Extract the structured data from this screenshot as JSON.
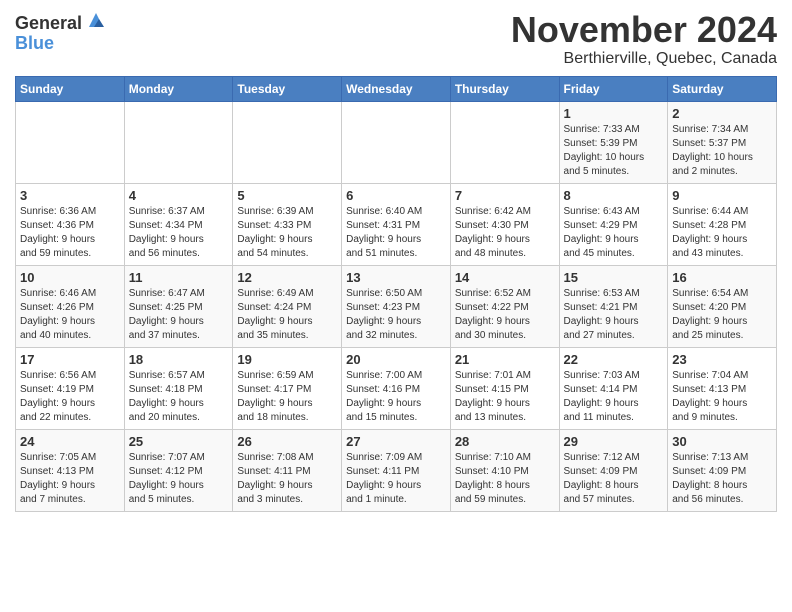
{
  "logo": {
    "general": "General",
    "blue": "Blue"
  },
  "header": {
    "month": "November 2024",
    "location": "Berthierville, Quebec, Canada"
  },
  "weekdays": [
    "Sunday",
    "Monday",
    "Tuesday",
    "Wednesday",
    "Thursday",
    "Friday",
    "Saturday"
  ],
  "weeks": [
    [
      {
        "day": "",
        "info": ""
      },
      {
        "day": "",
        "info": ""
      },
      {
        "day": "",
        "info": ""
      },
      {
        "day": "",
        "info": ""
      },
      {
        "day": "",
        "info": ""
      },
      {
        "day": "1",
        "info": "Sunrise: 7:33 AM\nSunset: 5:39 PM\nDaylight: 10 hours\nand 5 minutes."
      },
      {
        "day": "2",
        "info": "Sunrise: 7:34 AM\nSunset: 5:37 PM\nDaylight: 10 hours\nand 2 minutes."
      }
    ],
    [
      {
        "day": "3",
        "info": "Sunrise: 6:36 AM\nSunset: 4:36 PM\nDaylight: 9 hours\nand 59 minutes."
      },
      {
        "day": "4",
        "info": "Sunrise: 6:37 AM\nSunset: 4:34 PM\nDaylight: 9 hours\nand 56 minutes."
      },
      {
        "day": "5",
        "info": "Sunrise: 6:39 AM\nSunset: 4:33 PM\nDaylight: 9 hours\nand 54 minutes."
      },
      {
        "day": "6",
        "info": "Sunrise: 6:40 AM\nSunset: 4:31 PM\nDaylight: 9 hours\nand 51 minutes."
      },
      {
        "day": "7",
        "info": "Sunrise: 6:42 AM\nSunset: 4:30 PM\nDaylight: 9 hours\nand 48 minutes."
      },
      {
        "day": "8",
        "info": "Sunrise: 6:43 AM\nSunset: 4:29 PM\nDaylight: 9 hours\nand 45 minutes."
      },
      {
        "day": "9",
        "info": "Sunrise: 6:44 AM\nSunset: 4:28 PM\nDaylight: 9 hours\nand 43 minutes."
      }
    ],
    [
      {
        "day": "10",
        "info": "Sunrise: 6:46 AM\nSunset: 4:26 PM\nDaylight: 9 hours\nand 40 minutes."
      },
      {
        "day": "11",
        "info": "Sunrise: 6:47 AM\nSunset: 4:25 PM\nDaylight: 9 hours\nand 37 minutes."
      },
      {
        "day": "12",
        "info": "Sunrise: 6:49 AM\nSunset: 4:24 PM\nDaylight: 9 hours\nand 35 minutes."
      },
      {
        "day": "13",
        "info": "Sunrise: 6:50 AM\nSunset: 4:23 PM\nDaylight: 9 hours\nand 32 minutes."
      },
      {
        "day": "14",
        "info": "Sunrise: 6:52 AM\nSunset: 4:22 PM\nDaylight: 9 hours\nand 30 minutes."
      },
      {
        "day": "15",
        "info": "Sunrise: 6:53 AM\nSunset: 4:21 PM\nDaylight: 9 hours\nand 27 minutes."
      },
      {
        "day": "16",
        "info": "Sunrise: 6:54 AM\nSunset: 4:20 PM\nDaylight: 9 hours\nand 25 minutes."
      }
    ],
    [
      {
        "day": "17",
        "info": "Sunrise: 6:56 AM\nSunset: 4:19 PM\nDaylight: 9 hours\nand 22 minutes."
      },
      {
        "day": "18",
        "info": "Sunrise: 6:57 AM\nSunset: 4:18 PM\nDaylight: 9 hours\nand 20 minutes."
      },
      {
        "day": "19",
        "info": "Sunrise: 6:59 AM\nSunset: 4:17 PM\nDaylight: 9 hours\nand 18 minutes."
      },
      {
        "day": "20",
        "info": "Sunrise: 7:00 AM\nSunset: 4:16 PM\nDaylight: 9 hours\nand 15 minutes."
      },
      {
        "day": "21",
        "info": "Sunrise: 7:01 AM\nSunset: 4:15 PM\nDaylight: 9 hours\nand 13 minutes."
      },
      {
        "day": "22",
        "info": "Sunrise: 7:03 AM\nSunset: 4:14 PM\nDaylight: 9 hours\nand 11 minutes."
      },
      {
        "day": "23",
        "info": "Sunrise: 7:04 AM\nSunset: 4:13 PM\nDaylight: 9 hours\nand 9 minutes."
      }
    ],
    [
      {
        "day": "24",
        "info": "Sunrise: 7:05 AM\nSunset: 4:13 PM\nDaylight: 9 hours\nand 7 minutes."
      },
      {
        "day": "25",
        "info": "Sunrise: 7:07 AM\nSunset: 4:12 PM\nDaylight: 9 hours\nand 5 minutes."
      },
      {
        "day": "26",
        "info": "Sunrise: 7:08 AM\nSunset: 4:11 PM\nDaylight: 9 hours\nand 3 minutes."
      },
      {
        "day": "27",
        "info": "Sunrise: 7:09 AM\nSunset: 4:11 PM\nDaylight: 9 hours\nand 1 minute."
      },
      {
        "day": "28",
        "info": "Sunrise: 7:10 AM\nSunset: 4:10 PM\nDaylight: 8 hours\nand 59 minutes."
      },
      {
        "day": "29",
        "info": "Sunrise: 7:12 AM\nSunset: 4:09 PM\nDaylight: 8 hours\nand 57 minutes."
      },
      {
        "day": "30",
        "info": "Sunrise: 7:13 AM\nSunset: 4:09 PM\nDaylight: 8 hours\nand 56 minutes."
      }
    ]
  ]
}
